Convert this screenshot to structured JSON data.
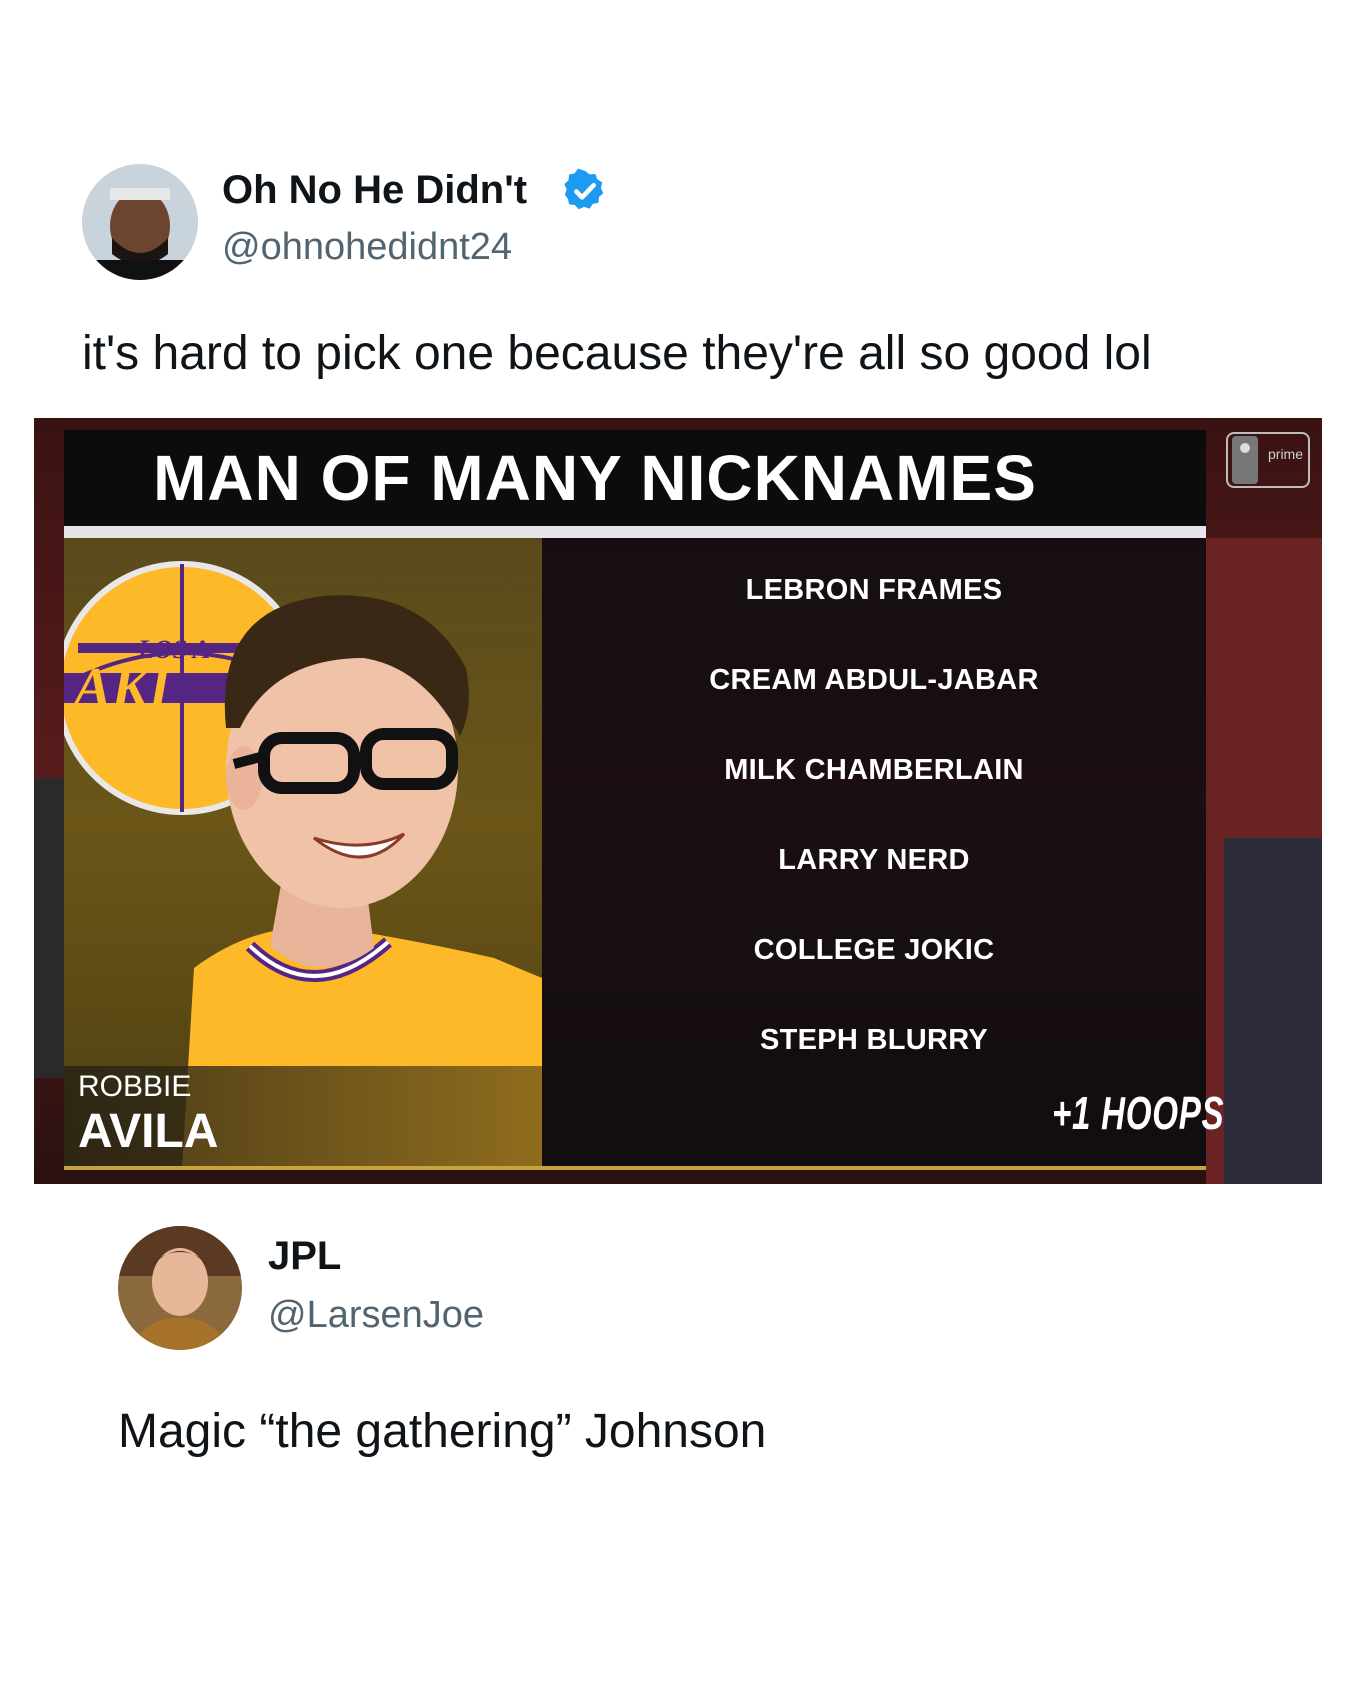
{
  "tweet1": {
    "name": "Oh No He Didn't",
    "handle": "@ohnohedidnt24",
    "text": "it's hard to pick one because they're all so good lol",
    "verified_color": "#1d9bf0"
  },
  "graphic": {
    "title": "MAN OF MANY NICKNAMES",
    "player_first": "ROBBIE",
    "player_last": "AVILA",
    "nicknames": [
      "LEBRON FRAMES",
      "CREAM ABDUL-JABAR",
      "MILK CHAMBERLAIN",
      "LARRY NERD",
      "COLLEGE JOKIC",
      "STEPH BLURRY"
    ],
    "watermark": "+1 HOOPS",
    "badge_label": "prime",
    "accent_color": "#c9a43a"
  },
  "tweet2": {
    "name": "JPL",
    "handle": "@LarsenJoe",
    "text": "Magic “the gathering” Johnson"
  }
}
